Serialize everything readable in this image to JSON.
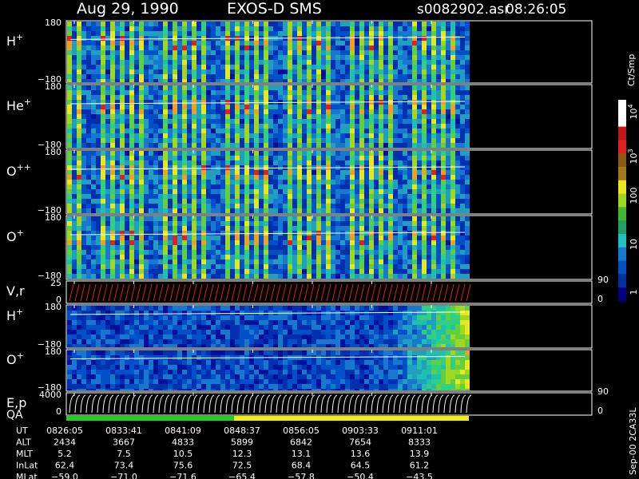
{
  "header": {
    "date": "Aug 29, 1990",
    "instrument": "EXOS-D SMS",
    "filename": "s0082902.asr",
    "time": "08:26:05"
  },
  "chart_data": {
    "type": "heatmap",
    "panels": [
      {
        "label": "H",
        "sup": "+",
        "ytop": "180",
        "ybot": "−180",
        "kind": "spec"
      },
      {
        "label": "He",
        "sup": "+",
        "ytop": "180",
        "ybot": "−180",
        "kind": "spec"
      },
      {
        "label": "O",
        "sup": "++",
        "ytop": "180",
        "ybot": "−180",
        "kind": "spec"
      },
      {
        "label": "O",
        "sup": "+",
        "ytop": "180",
        "ybot": "−180",
        "kind": "spec"
      },
      {
        "label": "V,r",
        "sup": "",
        "ytop": "25",
        "ybot": "0",
        "kind": "vr",
        "rtop": "90",
        "rbot": "0"
      },
      {
        "label": "H",
        "sup": "+",
        "ytop": "180",
        "ybot": "−180",
        "kind": "spec"
      },
      {
        "label": "O",
        "sup": "+",
        "ytop": "180",
        "ybot": "−180",
        "kind": "spec"
      },
      {
        "label": "E,p",
        "sup": "",
        "ytop": "4000",
        "ybot": "0",
        "kind": "ep",
        "rtop": "90",
        "rbot": "0"
      }
    ],
    "qa_label": "QA",
    "colorbar": {
      "unit": "Ct/Smp",
      "ticks": [
        "10",
        "10",
        "100",
        "10",
        "1"
      ],
      "tick_sup": [
        "4",
        "3",
        "",
        "",
        ""
      ]
    },
    "side_label": "Sep-00 2CA33L",
    "time_table": {
      "rows": [
        {
          "name": "UT",
          "values": [
            "0826:05",
            "0833:41",
            "0841:09",
            "0848:37",
            "0856:05",
            "0903:33",
            "0911:01"
          ]
        },
        {
          "name": "ALT",
          "values": [
            "2434",
            "3667",
            "4833",
            "5899",
            "6842",
            "7654",
            "8333"
          ]
        },
        {
          "name": "MLT",
          "values": [
            "5.2",
            "7.5",
            "10.5",
            "12.3",
            "13.1",
            "13.6",
            "13.9"
          ]
        },
        {
          "name": "InLat",
          "values": [
            "62.4",
            "73.4",
            "75.6",
            "72.5",
            "68.4",
            "64.5",
            "61.2"
          ]
        },
        {
          "name": "MLat",
          "values": [
            "−59.0",
            "−71.0",
            "−71.6",
            "−65.4",
            "−57.8",
            "−50.4",
            "−43.5"
          ]
        }
      ]
    }
  }
}
